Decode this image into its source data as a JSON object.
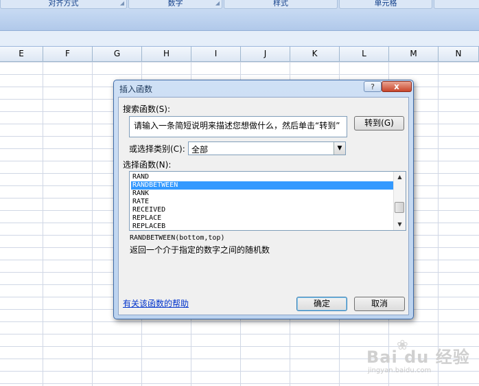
{
  "ribbon": {
    "groups": [
      "对齐方式",
      "数字",
      "样式",
      "单元格"
    ]
  },
  "columns": [
    "E",
    "F",
    "G",
    "H",
    "I",
    "J",
    "K",
    "L",
    "M",
    "N"
  ],
  "dialog": {
    "title": "插入函数",
    "help_btn": "?",
    "close_btn": "x",
    "search_label": "搜索函数(S):",
    "search_value": "请输入一条简短说明来描述您想做什么，然后单击“转到”",
    "goto_btn": "转到(G)",
    "category_label": "或选择类别(C):",
    "category_value": "全部",
    "func_label": "选择函数(N):",
    "functions": [
      "RAND",
      "RANDBETWEEN",
      "RANK",
      "RATE",
      "RECEIVED",
      "REPLACE",
      "REPLACEB"
    ],
    "selected_function": "RANDBETWEEN",
    "signature": "RANDBETWEEN(bottom,top)",
    "description": "返回一个介于指定的数字之间的随机数",
    "help_link": "有关该函数的帮助",
    "ok_btn": "确定",
    "cancel_btn": "取消"
  },
  "watermark": {
    "brand": "Bai du 经验",
    "url": "jingyan.baidu.com"
  }
}
